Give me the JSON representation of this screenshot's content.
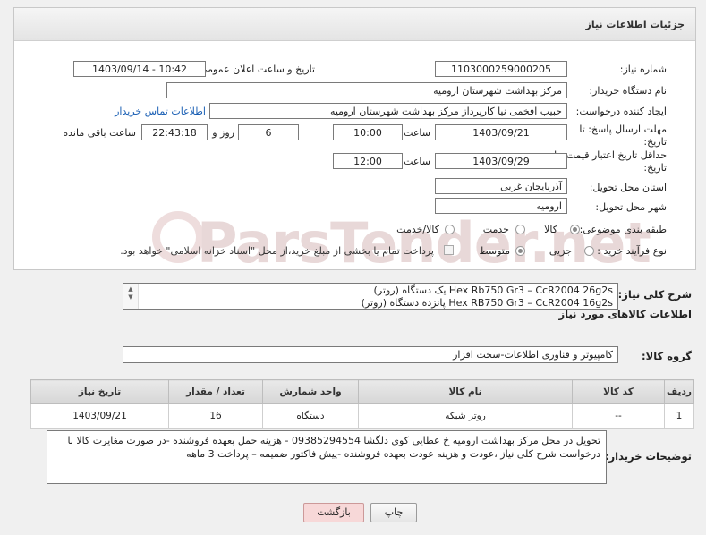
{
  "header": {
    "title": "جزئیات اطلاعات نیاز"
  },
  "form": {
    "need_number_label": "شماره نیاز:",
    "need_number": "1103000259000205",
    "announce_label": "تاریخ و ساعت اعلان عمومی:",
    "announce_value": "1403/09/14 - 10:42",
    "buyer_org_label": "نام دستگاه خریدار:",
    "buyer_org": "مرکز بهداشت شهرستان ارومیه",
    "requester_label": "ایجاد کننده درخواست:",
    "requester": "حبیب افخمی نیا کارپرداز مرکز بهداشت شهرستان ارومیه",
    "contact_link": "اطلاعات تماس خریدار",
    "reply_deadline_label_1": "مهلت ارسال پاسخ: تا",
    "reply_deadline_label_2": "تاریخ:",
    "reply_date": "1403/09/21",
    "time_label": "ساعت",
    "reply_time": "10:00",
    "days_value": "6",
    "days_label": "روز و",
    "remaining_time": "22:43:18",
    "remaining_label": "ساعت باقی مانده",
    "validity_label_1": "حداقل تاریخ اعتبار قیمت: تا",
    "validity_label_2": "تاریخ:",
    "validity_date": "1403/09/29",
    "validity_time_label": "ساعت",
    "validity_time": "12:00",
    "province_label": "استان محل تحویل:",
    "province": "آذربایجان غربی",
    "city_label": "شهر محل تحویل:",
    "city": "ارومیه",
    "category_label": "طبقه بندی موضوعی:",
    "category_options": [
      "کالا",
      "خدمت",
      "کالا/خدمت"
    ],
    "process_label": "نوع فرآیند خرید :",
    "process_options": [
      "جزیی",
      "متوسط"
    ],
    "payment_note": "پرداخت تمام یا بخشی از مبلغ خرید،از محل \"اسناد خزانه اسلامی\" خواهد بود."
  },
  "general_desc": {
    "label": "شرح کلی نیاز:",
    "line1": "Hex Rb750 Gr3 – CcR2004 26g2s یک دستگاه (روتر)",
    "line2": "Hex RB750 Gr3 – CcR2004 16g2s  پانزده دستگاه (روتر)"
  },
  "goods_info_title": "اطلاعات کالاهای مورد نیاز",
  "goods_group": {
    "label": "گروه کالا:",
    "value": "کامپیوتر و فناوری اطلاعات-سخت افزار"
  },
  "items_table": {
    "headers": [
      "ردیف",
      "کد کالا",
      "نام کالا",
      "واحد شمارش",
      "تعداد / مقدار",
      "تاریخ نیاز"
    ],
    "rows": [
      {
        "row": "1",
        "code": "--",
        "name": "روتر شبکه",
        "unit": "دستگاه",
        "qty": "16",
        "date": "1403/09/21"
      }
    ]
  },
  "buyer_notes": {
    "label": "توضیحات خریدار:",
    "text": "تحویل در محل مرکز بهداشت ارومیه خ عطایی کوی دلگشا 09385294554  - هزینه حمل بعهده فروشنده -در صورت مغایرت کالا  با درخواست شرح کلی نیاز ،عودت و هزینه عودت بعهده فروشنده -پیش فاکتور  ضمیمه – پرداخت 3 ماهه"
  },
  "buttons": {
    "print": "چاپ",
    "back": "بازگشت"
  },
  "watermark": "ParsTender.net"
}
